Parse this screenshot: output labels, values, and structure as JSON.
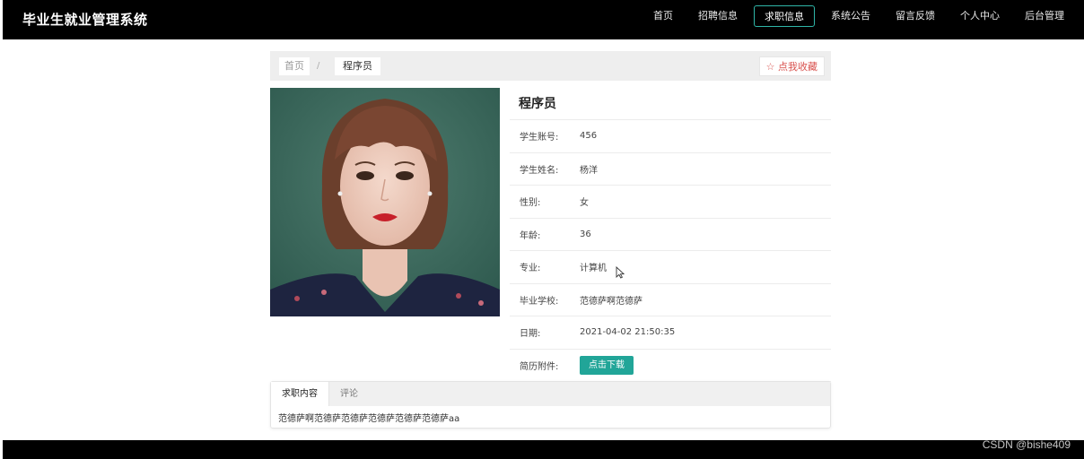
{
  "header": {
    "brand": "毕业生就业管理系统",
    "nav": [
      "首页",
      "招聘信息",
      "求职信息",
      "系统公告",
      "留言反馈",
      "个人中心",
      "后台管理"
    ],
    "active_index": 2
  },
  "breadcrumb": {
    "home": "首页",
    "separator": "/",
    "current": "程序员"
  },
  "favorite_button": "☆ 点我收藏",
  "detail": {
    "title": "程序员",
    "rows": [
      {
        "label": "学生账号:",
        "value": "456"
      },
      {
        "label": "学生姓名:",
        "value": "杨洋"
      },
      {
        "label": "性别:",
        "value": "女"
      },
      {
        "label": "年龄:",
        "value": "36"
      },
      {
        "label": "专业:",
        "value": "计算机"
      },
      {
        "label": "毕业学校:",
        "value": "范德萨啊范德萨"
      },
      {
        "label": "日期:",
        "value": "2021-04-02 21:50:35"
      }
    ],
    "resume_label": "简历附件:",
    "download_button": "点击下载"
  },
  "tabs": {
    "items": [
      "求职内容",
      "评论"
    ],
    "content": "范德萨啊范德萨范德萨范德萨范德萨范德萨aa"
  },
  "watermark": "CSDN @bishe409",
  "colors": {
    "accent": "#21a598",
    "favorite": "#d9534f",
    "nav_bg": "#000000"
  }
}
